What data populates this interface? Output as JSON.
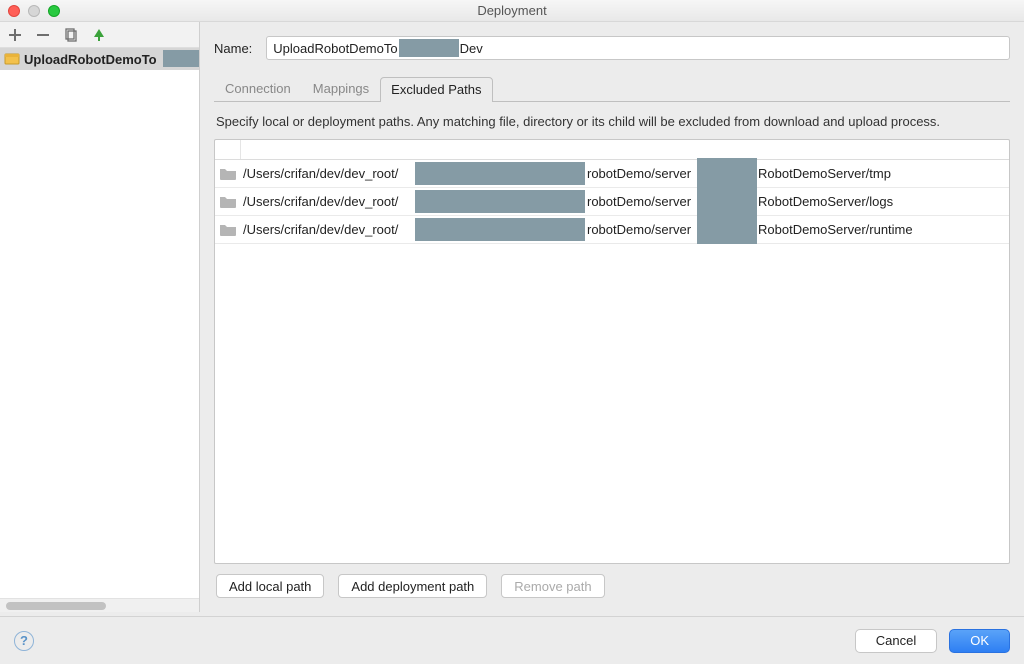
{
  "window": {
    "title": "Deployment"
  },
  "sidebar": {
    "items": [
      {
        "label": "UploadRobotDemoTo"
      }
    ]
  },
  "form": {
    "name_label": "Name:",
    "name_value_prefix": "UploadRobotDemoTo",
    "name_value_suffix": "Dev"
  },
  "tabs": [
    {
      "label": "Connection"
    },
    {
      "label": "Mappings"
    },
    {
      "label": "Excluded Paths"
    }
  ],
  "active_tab_index": 2,
  "description": "Specify local or deployment paths. Any matching file, directory or its child will be excluded from download and upload process.",
  "paths": [
    {
      "prefix": "/Users/crifan/dev/dev_root/",
      "mid": "robotDemo/server",
      "suffix": "RobotDemoServer/tmp"
    },
    {
      "prefix": "/Users/crifan/dev/dev_root/",
      "mid": "robotDemo/server",
      "suffix": "RobotDemoServer/logs"
    },
    {
      "prefix": "/Users/crifan/dev/dev_root/",
      "mid": "robotDemo/server",
      "suffix": "RobotDemoServer/runtime"
    }
  ],
  "buttons": {
    "add_local": "Add local path",
    "add_deploy": "Add deployment path",
    "remove": "Remove path",
    "cancel": "Cancel",
    "ok": "OK"
  }
}
